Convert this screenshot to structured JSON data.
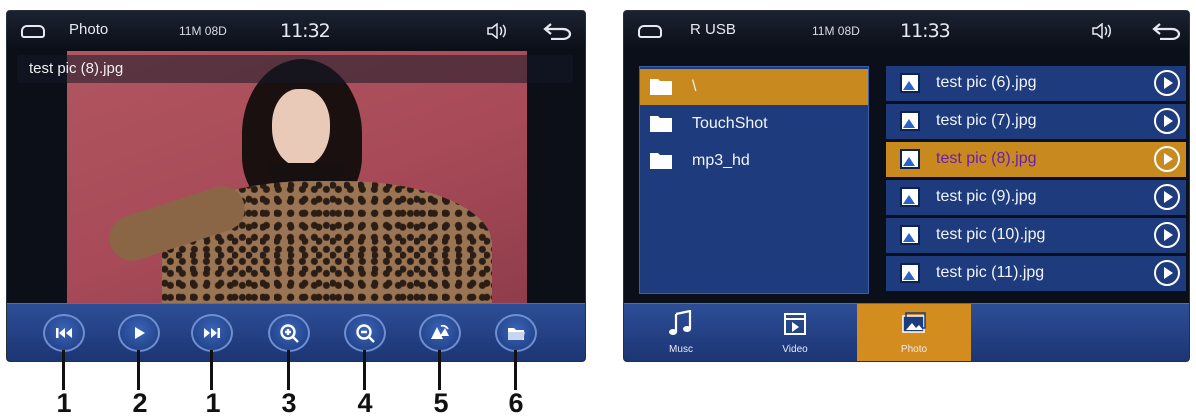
{
  "left_screen": {
    "status": {
      "title": "Photo",
      "memory": "11M 08D",
      "clock": "11:32"
    },
    "filename": "test pic (8).jpg",
    "controls": [
      {
        "name": "previous-button",
        "icon": "skip-back-icon"
      },
      {
        "name": "play-button",
        "icon": "play-icon"
      },
      {
        "name": "next-button",
        "icon": "skip-forward-icon"
      },
      {
        "name": "zoom-in-button",
        "icon": "zoom-in-icon"
      },
      {
        "name": "zoom-out-button",
        "icon": "zoom-out-icon"
      },
      {
        "name": "rotate-button",
        "icon": "rotate-icon"
      },
      {
        "name": "folder-button",
        "icon": "folder-open-icon"
      }
    ],
    "callouts": [
      "1",
      "2",
      "1",
      "3",
      "4",
      "5",
      "6"
    ]
  },
  "right_screen": {
    "status": {
      "title": "R USB",
      "memory": "11M 08D",
      "clock": "11:33"
    },
    "folders": [
      {
        "label": "\\",
        "selected": true
      },
      {
        "label": "TouchShot",
        "selected": false
      },
      {
        "label": "mp3_hd",
        "selected": false
      }
    ],
    "files": [
      {
        "label": "test pic (6).jpg",
        "selected": false
      },
      {
        "label": "test pic (7).jpg",
        "selected": false
      },
      {
        "label": "test pic (8).jpg",
        "selected": true
      },
      {
        "label": "test pic (9).jpg",
        "selected": false
      },
      {
        "label": "test pic (10).jpg",
        "selected": false
      },
      {
        "label": "test pic (11).jpg",
        "selected": false
      }
    ],
    "tabs": [
      {
        "label": "Musc",
        "icon": "music-icon",
        "active": false
      },
      {
        "label": "Video",
        "icon": "video-icon",
        "active": false
      },
      {
        "label": "Photo",
        "icon": "photo-icon",
        "active": true
      }
    ]
  },
  "colors": {
    "accent": "#c88a1f",
    "panel_blue": "#1d3b7d",
    "bar_blue": "#2d4e96",
    "selected_text": "#6a1fb0"
  }
}
